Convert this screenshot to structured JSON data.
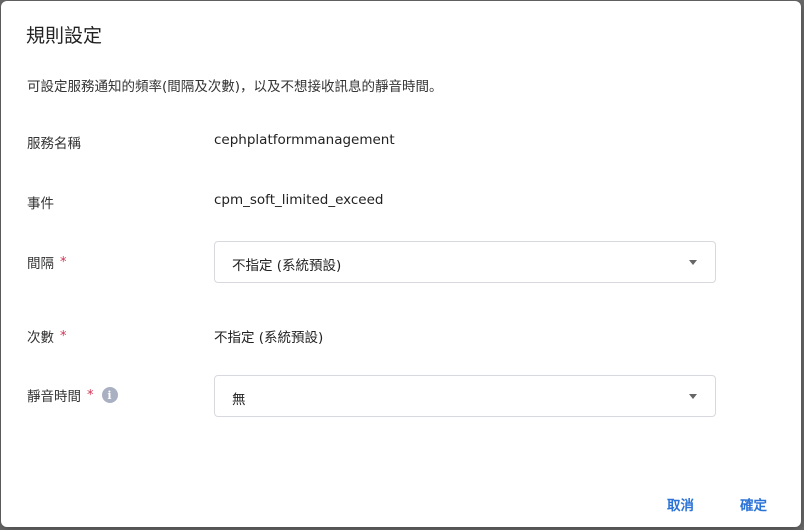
{
  "dialog": {
    "title": "規則設定",
    "description": "可設定服務通知的頻率(間隔及次數)，以及不想接收訊息的靜音時間。"
  },
  "fields": {
    "service_name": {
      "label": "服務名稱",
      "value": "cephplatformmanagement"
    },
    "event": {
      "label": "事件",
      "value": "cpm_soft_limited_exceed"
    },
    "interval": {
      "label": "間隔",
      "required_mark": "*",
      "value": "不指定 (系統預設)"
    },
    "count": {
      "label": "次數",
      "required_mark": "*",
      "value": "不指定 (系統預設)"
    },
    "mute_time": {
      "label": "靜音時間",
      "required_mark": "*",
      "info_icon": "i",
      "value": "無"
    }
  },
  "buttons": {
    "cancel": "取消",
    "confirm": "確定"
  },
  "colors": {
    "accent": "#2b73d6",
    "required": "#d32f4f",
    "overlay": "#6b6b6b"
  },
  "icons": {
    "dropdown": "chevron-down-icon",
    "info": "info-icon"
  }
}
